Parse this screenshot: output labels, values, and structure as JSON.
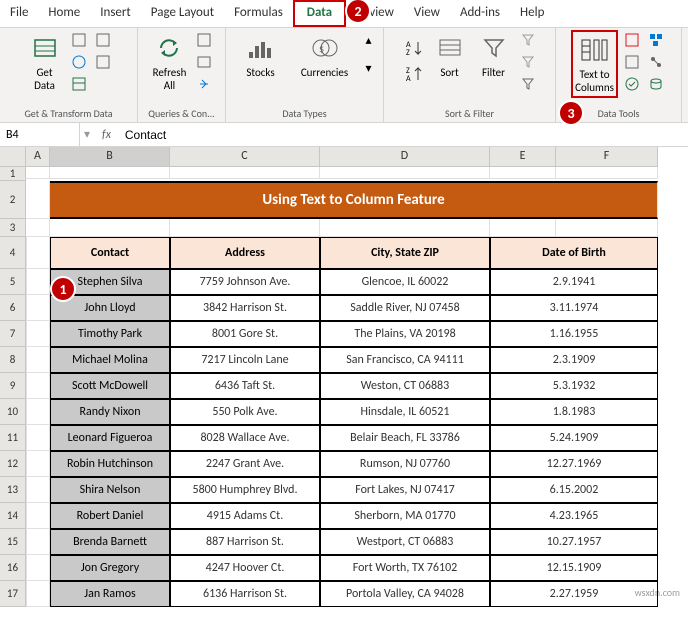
{
  "menu": {
    "items": [
      "File",
      "Home",
      "Insert",
      "Page Layout",
      "Formulas",
      "Data",
      "Review",
      "View",
      "Add-ins",
      "Help"
    ],
    "activeIndex": 5
  },
  "ribbon": {
    "groups": {
      "getTransform": {
        "label": "Get & Transform Data",
        "getData": "Get\nData"
      },
      "queries": {
        "label": "Queries & Con...",
        "refresh": "Refresh\nAll"
      },
      "dataTypes": {
        "label": "Data Types",
        "stocks": "Stocks",
        "currencies": "Currencies"
      },
      "sortFilter": {
        "label": "Sort & Filter",
        "sort": "Sort",
        "filter": "Filter"
      },
      "dataTools": {
        "label": "Data Tools",
        "textToColumns": "Text to\nColumns"
      }
    }
  },
  "formulaBar": {
    "nameBox": "B4",
    "fx": "fx",
    "value": "Contact"
  },
  "columns": [
    "A",
    "B",
    "C",
    "D",
    "E",
    "F"
  ],
  "banner": "Using Text to Column Feature",
  "headers": {
    "contact": "Contact",
    "address": "Address",
    "cityStateZip": "City, State ZIP",
    "dob": "Date of Birth"
  },
  "rows": [
    {
      "n": 5,
      "contact": "Stephen Silva",
      "address": "7759 Johnson Ave.",
      "city": "Glencoe, IL   60022",
      "dob": "2.9.1941"
    },
    {
      "n": 6,
      "contact": "John Lloyd",
      "address": "3842 Harrison St.",
      "city": "Saddle River, NJ  07458",
      "dob": "3.11.1974"
    },
    {
      "n": 7,
      "contact": "Timothy Park",
      "address": "8001 Gore St.",
      "city": "The Plains, VA   20198",
      "dob": "1.16.1955"
    },
    {
      "n": 8,
      "contact": "Michael Molina",
      "address": "7217 Lincoln Lane",
      "city": "San Francisco, CA   94111",
      "dob": "2.3.1909"
    },
    {
      "n": 9,
      "contact": "Scott McDowell",
      "address": "6436 Taft St.",
      "city": "Weston, CT   06883",
      "dob": "5.3.1932"
    },
    {
      "n": 10,
      "contact": "Randy Nixon",
      "address": "550 Polk Ave.",
      "city": "Hinsdale, IL   60521",
      "dob": "1.8.1983"
    },
    {
      "n": 11,
      "contact": "Leonard Figueroa",
      "address": "8028 Wallace Ave.",
      "city": "Belair Beach, FL   33786",
      "dob": "5.24.1909"
    },
    {
      "n": 12,
      "contact": "Robin Hutchinson",
      "address": "2247 Grant Ave.",
      "city": "Rumson, NJ   07760",
      "dob": "12.27.1969"
    },
    {
      "n": 13,
      "contact": "Shira Nelson",
      "address": "5800 Humphrey Blvd.",
      "city": "Fort Lakes, NJ   07417",
      "dob": "6.15.2002"
    },
    {
      "n": 14,
      "contact": "Robert Daniel",
      "address": "4915 Adams Ct.",
      "city": "Sherborn, MA   01770",
      "dob": "4.23.1965"
    },
    {
      "n": 15,
      "contact": "Brenda Barnett",
      "address": "887 Harrison St.",
      "city": "Westport, CT   06883",
      "dob": "10.27.1957"
    },
    {
      "n": 16,
      "contact": "Jon Gregory",
      "address": "4247 Hoover Ct.",
      "city": "Fort Worth, TX   76102",
      "dob": "12.15.1909"
    },
    {
      "n": 17,
      "contact": "Jan Ramos",
      "address": "6136 Harrison St.",
      "city": "Portola Valley, CA   94028",
      "dob": "2.27.1959"
    }
  ],
  "badges": {
    "b1": "1",
    "b2": "2",
    "b3": "3"
  },
  "watermark": "wsxdn.com"
}
